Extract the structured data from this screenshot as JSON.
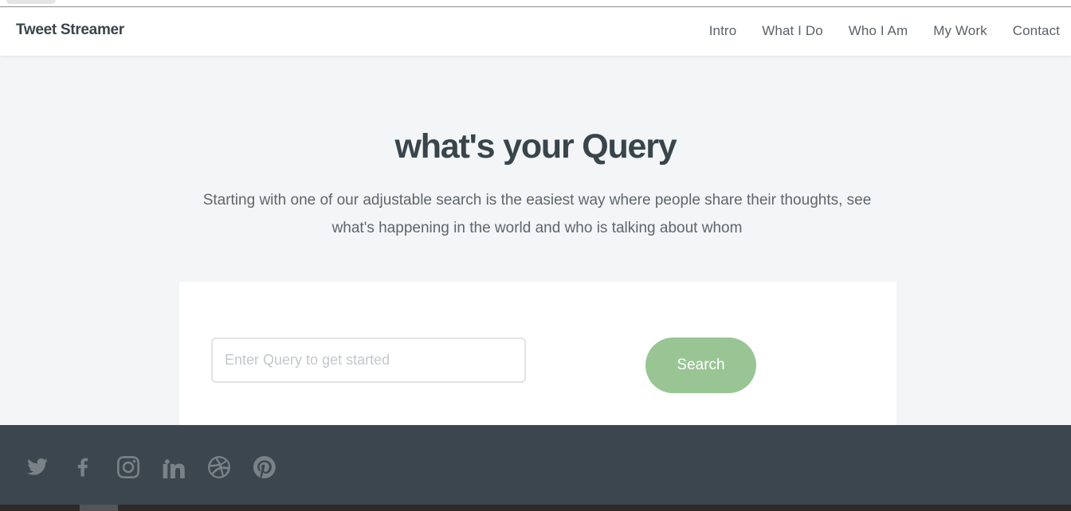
{
  "brand": {
    "name": "Tweet Streamer"
  },
  "nav": {
    "items": [
      {
        "label": "Intro"
      },
      {
        "label": "What I Do"
      },
      {
        "label": "Who I Am"
      },
      {
        "label": "My Work"
      },
      {
        "label": "Contact"
      }
    ]
  },
  "hero": {
    "title": "what's your Query",
    "text": "Starting with one of our adjustable search is the easiest way where people share their thoughts, see what's happening in the world and who is talking about whom"
  },
  "search": {
    "placeholder": "Enter Query to get started",
    "value": "",
    "button_label": "Search"
  },
  "footer": {
    "social_icons": [
      "twitter-icon",
      "facebook-icon",
      "instagram-icon",
      "linkedin-icon",
      "dribbble-icon",
      "pinterest-icon"
    ]
  },
  "colors": {
    "page_bg": "#f3f5f6",
    "heading": "#39454b",
    "accent_button": "#99c595",
    "footer_bg": "#3b464e",
    "icon_gray": "#7a8288"
  }
}
